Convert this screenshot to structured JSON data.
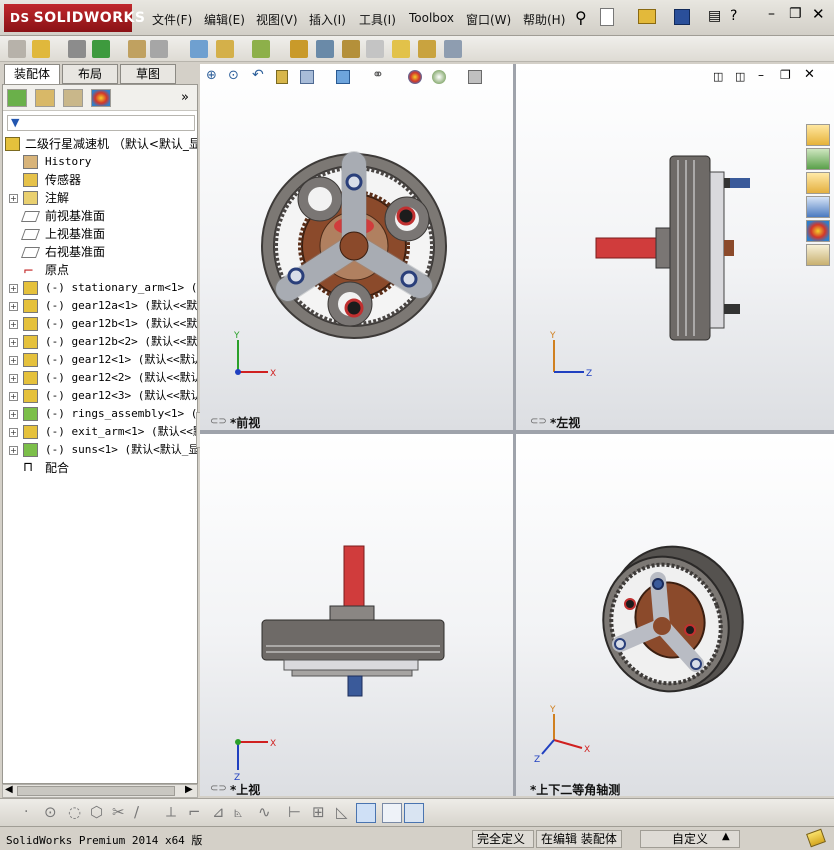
{
  "app": {
    "logo_ds": "DS",
    "logo_text": "SOLIDWORKS"
  },
  "menu": [
    "文件(F)",
    "编辑(E)",
    "视图(V)",
    "插入(I)",
    "工具(I)",
    "Toolbox",
    "窗口(W)",
    "帮助(H)"
  ],
  "tabs": [
    "装配体",
    "布局",
    "草图"
  ],
  "tree": {
    "root": "二级行星减速机 （默认<默认_显",
    "items": [
      {
        "label": "History",
        "mono": true,
        "expand": false,
        "icon": "history-icon"
      },
      {
        "label": "传感器",
        "mono": false,
        "expand": false,
        "icon": "sensor-icon"
      },
      {
        "label": "注解",
        "mono": false,
        "expand": true,
        "icon": "annotation-icon"
      },
      {
        "label": "前视基准面",
        "mono": false,
        "expand": false,
        "icon": "plane-icon"
      },
      {
        "label": "上视基准面",
        "mono": false,
        "expand": false,
        "icon": "plane-icon"
      },
      {
        "label": "右视基准面",
        "mono": false,
        "expand": false,
        "icon": "plane-icon"
      },
      {
        "label": "原点",
        "mono": false,
        "expand": false,
        "icon": "origin-icon"
      },
      {
        "label": "(-) stationary_arm<1> (默认",
        "mono": true,
        "expand": true,
        "icon": "part-icon"
      },
      {
        "label": "(-) gear12a<1> (默认<<默认",
        "mono": true,
        "expand": true,
        "icon": "part-icon"
      },
      {
        "label": "(-) gear12b<1> (默认<<默认",
        "mono": true,
        "expand": true,
        "icon": "part-icon"
      },
      {
        "label": "(-) gear12b<2> (默认<<默认",
        "mono": true,
        "expand": true,
        "icon": "part-icon"
      },
      {
        "label": "(-) gear12<1> (默认<<默认",
        "mono": true,
        "expand": true,
        "icon": "part-icon"
      },
      {
        "label": "(-) gear12<2> (默认<<默认",
        "mono": true,
        "expand": true,
        "icon": "part-icon"
      },
      {
        "label": "(-) gear12<3> (默认<<默认",
        "mono": true,
        "expand": true,
        "icon": "part-icon"
      },
      {
        "label": "(-) rings_assembly<1> (默认",
        "mono": true,
        "expand": true,
        "icon": "assembly-icon"
      },
      {
        "label": "(-) exit_arm<1> (默认<<默认",
        "mono": true,
        "expand": true,
        "icon": "part-icon"
      },
      {
        "label": "(-) suns<1> (默认<默认_显",
        "mono": true,
        "expand": true,
        "icon": "assembly-icon"
      },
      {
        "label": "配合",
        "mono": false,
        "expand": false,
        "icon": "mates-icon"
      }
    ]
  },
  "views": [
    {
      "label": "*前视",
      "axes": [
        "Y",
        "X"
      ]
    },
    {
      "label": "*左视",
      "axes": [
        "Y",
        "Z"
      ]
    },
    {
      "label": "*上视",
      "axes": [
        "X",
        "Z"
      ]
    },
    {
      "label": "*上下二等角轴测",
      "axes": [
        "Y",
        "X",
        "Z"
      ]
    }
  ],
  "status": {
    "version": "SolidWorks Premium 2014 x64 版",
    "defined": "完全定义",
    "editing": "在编辑 装配体",
    "custom": "自定义"
  },
  "colors": {
    "accent": "#c0282c",
    "gear": "#8b4a2b",
    "shaft": "#d03c3c",
    "steel": "#7f7b78",
    "arm": "#b9bcc4"
  }
}
